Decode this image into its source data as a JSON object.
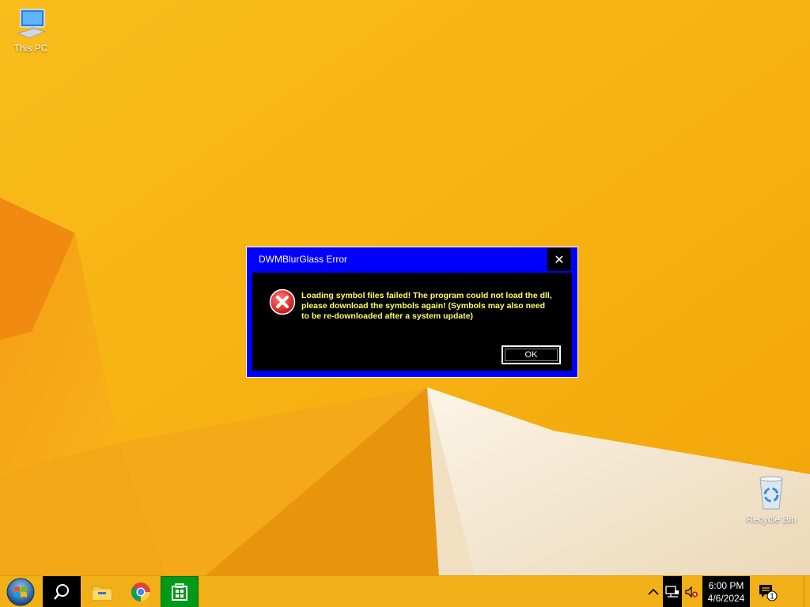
{
  "desktop": {
    "icons": [
      {
        "label": "This PC",
        "icon": "monitor-icon"
      },
      {
        "label": "Recycle Bin",
        "icon": "recycle-bin-icon"
      }
    ]
  },
  "dialog": {
    "title": "DWMBlurGlass Error",
    "close_label": "✕",
    "message": "Loading symbol files failed! The program could not load the dll, please download the symbols again! (Symbols may also need to be re-downloaded after a system update)",
    "ok_label": "OK",
    "icon": "error-icon"
  },
  "taskbar": {
    "pinned": [
      "start-orb-icon",
      "search-icon",
      "file-explorer-icon",
      "chrome-icon",
      "app-icon"
    ],
    "tray": [
      "chevron-up-icon",
      "network-icon",
      "volume-muted-icon"
    ],
    "clock": {
      "time": "6:00 PM",
      "date": "4/6/2024"
    },
    "notifications": {
      "count": "1"
    }
  },
  "colors": {
    "wallpaper": "#f7b413",
    "dialog_frame": "#0000ff",
    "dialog_body": "#000000",
    "message_text": "#ffff66",
    "taskbar": "#f2b018",
    "active_app": "#009a18"
  }
}
